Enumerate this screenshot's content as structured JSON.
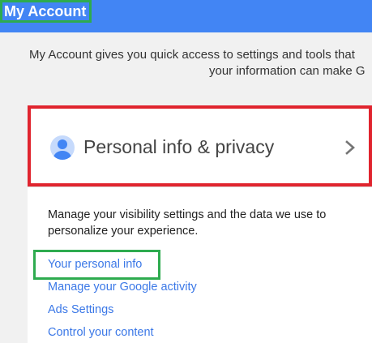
{
  "header": {
    "title": "My Account",
    "background_color": "#4285f4"
  },
  "intro": {
    "line1": "My Account gives you quick access to settings and tools that",
    "line2": "your information can make G"
  },
  "card": {
    "title": "Personal info & privacy",
    "icon": "person-avatar-icon",
    "description": "Manage your visibility settings and the data we use to personalize your experience.",
    "links": [
      "Your personal info",
      "Manage your Google activity",
      "Ads Settings",
      "Control your content"
    ]
  },
  "annotations": {
    "highlight_color_green": "#2eab4f",
    "highlight_color_red": "#e0242e"
  }
}
